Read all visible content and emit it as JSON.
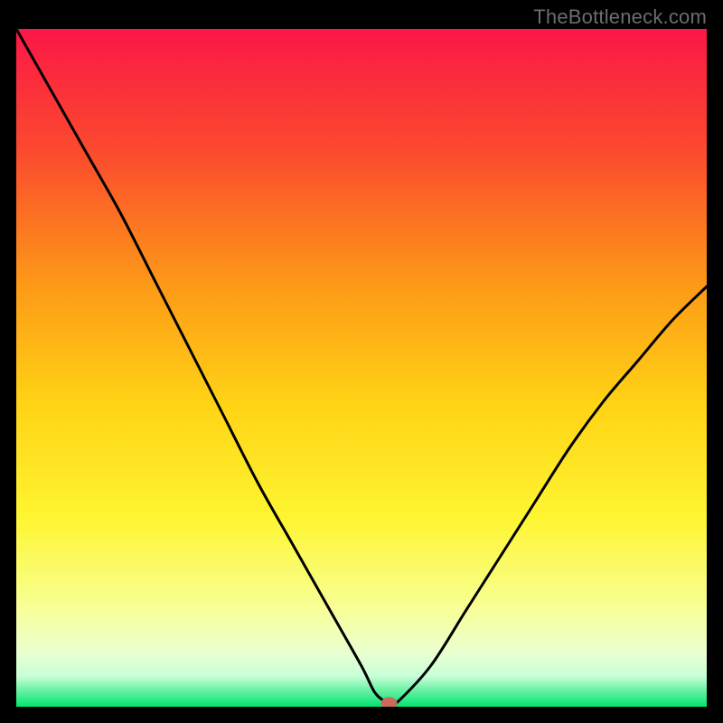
{
  "watermark": "TheBottleneck.com",
  "chart_data": {
    "type": "line",
    "title": "",
    "xlabel": "",
    "ylabel": "",
    "xlim": [
      0,
      100
    ],
    "ylim": [
      0,
      100
    ],
    "x": [
      0,
      5,
      10,
      15,
      20,
      25,
      30,
      35,
      40,
      45,
      50,
      52,
      54,
      55,
      60,
      65,
      70,
      75,
      80,
      85,
      90,
      95,
      100
    ],
    "y": [
      100,
      91,
      82,
      73,
      63,
      53,
      43,
      33,
      24,
      15,
      6,
      2,
      0.5,
      0.5,
      6,
      14,
      22,
      30,
      38,
      45,
      51,
      57,
      62
    ],
    "marker": {
      "x": 54,
      "y": 0.5
    },
    "annotations": []
  },
  "colors": {
    "gradient_top": "#fb1747",
    "gradient_upper": "#fb671f",
    "gradient_mid": "#ffd215",
    "gradient_lower": "#f8ff66",
    "gradient_pale": "#f5ffd6",
    "gradient_bottom": "#00e46f",
    "curve": "#000000",
    "marker_fill": "#cc6a5d",
    "frame": "#000000"
  }
}
